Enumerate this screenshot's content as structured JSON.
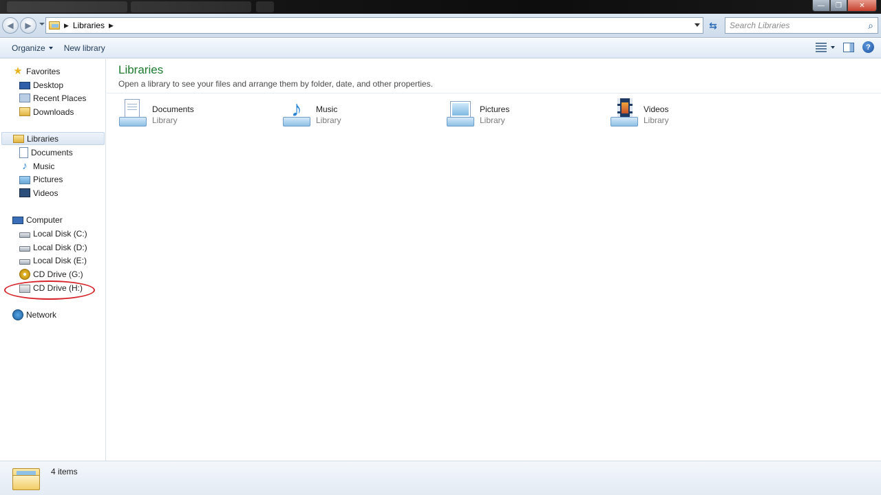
{
  "titlebar": {
    "caption_min": "—",
    "caption_max": "❐",
    "caption_close": "✕"
  },
  "address": {
    "breadcrumb": "Libraries",
    "back_glyph": "◀",
    "forward_glyph": "▶"
  },
  "search": {
    "placeholder": "Search Libraries"
  },
  "toolbar": {
    "organize_label": "Organize",
    "new_library_label": "New library",
    "help_label": "?"
  },
  "sidebar": {
    "favorites": {
      "label": "Favorites",
      "items": [
        {
          "label": "Desktop",
          "icon": "desktop-icon"
        },
        {
          "label": "Recent Places",
          "icon": "recent-places-icon"
        },
        {
          "label": "Downloads",
          "icon": "downloads-icon"
        }
      ]
    },
    "libraries": {
      "label": "Libraries",
      "items": [
        {
          "label": "Documents",
          "icon": "documents-icon"
        },
        {
          "label": "Music",
          "icon": "music-icon"
        },
        {
          "label": "Pictures",
          "icon": "pictures-icon"
        },
        {
          "label": "Videos",
          "icon": "videos-icon"
        }
      ]
    },
    "computer": {
      "label": "Computer",
      "items": [
        {
          "label": "Local Disk (C:)",
          "icon": "system-disk-icon"
        },
        {
          "label": "Local Disk (D:)",
          "icon": "disk-icon"
        },
        {
          "label": "Local Disk (E:)",
          "icon": "disk-icon"
        },
        {
          "label": "CD Drive (G:)",
          "icon": "cd-icon"
        },
        {
          "label": "CD Drive (H:)",
          "icon": "cd-drive-icon"
        }
      ]
    },
    "network": {
      "label": "Network"
    }
  },
  "main": {
    "title": "Libraries",
    "subtitle": "Open a library to see your files and arrange them by folder, date, and other properties.",
    "libraries": [
      {
        "name": "Documents",
        "type": "Library"
      },
      {
        "name": "Music",
        "type": "Library"
      },
      {
        "name": "Pictures",
        "type": "Library"
      },
      {
        "name": "Videos",
        "type": "Library"
      }
    ]
  },
  "status": {
    "item_count": "4 items"
  },
  "colors": {
    "title_green": "#1e7a2e",
    "annotation_red": "#d8232a",
    "link_blue": "#1e3957"
  }
}
